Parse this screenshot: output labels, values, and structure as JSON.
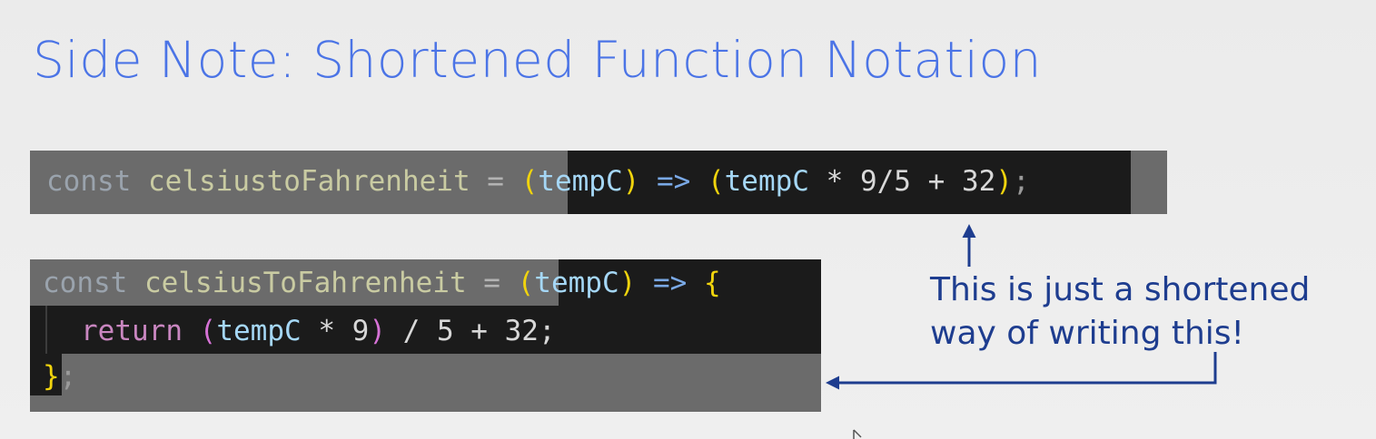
{
  "slide": {
    "title": "Side Note: Shortened Function Notation"
  },
  "code_short": {
    "keyword": "const",
    "name": "celsiustoFahrenheit",
    "assign": "=",
    "open_paren": "(",
    "param": "tempC",
    "close_paren": ")",
    "arrow": "=>",
    "body_open": "(",
    "body_ident": "tempC",
    "body_rest": " * 9/5 + 32",
    "body_close": ")",
    "semicolon": ";"
  },
  "code_full": {
    "keyword": "const",
    "name": "celsiusToFahrenheit",
    "assign": "=",
    "open_paren": "(",
    "param": "tempC",
    "close_paren": ")",
    "arrow": "=>",
    "brace_open": "{",
    "return_kw": "return",
    "expr_open": "(",
    "expr_ident": "tempC",
    "expr_mult": " * 9",
    "expr_close": ")",
    "expr_rest": " / 5 + 32;",
    "brace_close": "}",
    "semicolon": ";"
  },
  "annotation": {
    "line1": "This is just a shortened",
    "line2": "way of writing this!"
  },
  "colors": {
    "title": "#4b74e6",
    "annotation": "#1e3d8f",
    "arrow": "#1e3d8f"
  }
}
